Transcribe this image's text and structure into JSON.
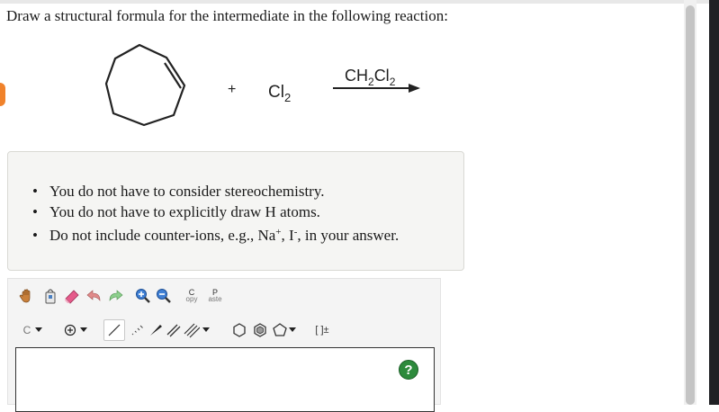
{
  "question": "Draw a structural formula for the intermediate in the following reaction:",
  "reaction": {
    "plus": "+",
    "reagent_main": "Cl",
    "reagent_sub": "2",
    "solvent_main": "CH",
    "solvent_sub1": "2",
    "solvent_mid": "Cl",
    "solvent_sub2": "2"
  },
  "notes": {
    "item1": "You do not have to consider stereochemistry.",
    "item2": "You do not have to explicitly draw H atoms.",
    "item3_prefix": "Do not include counter-ions, e.g., Na",
    "item3_sup1": "+",
    "item3_mid": ", I",
    "item3_sup2": "-",
    "item3_suffix": ", in your answer."
  },
  "toolbar": {
    "copy_label_top": "C",
    "copy_label_bottom": "opy",
    "paste_label_top": "P",
    "paste_label_bottom": "aste",
    "element_label": "C",
    "bracket_label": "[ ]±"
  },
  "help_label": "?",
  "colors": {
    "accent_tab": "#f0822b",
    "help_green": "#2d8a3c",
    "notes_bg": "#f5f5f3"
  }
}
